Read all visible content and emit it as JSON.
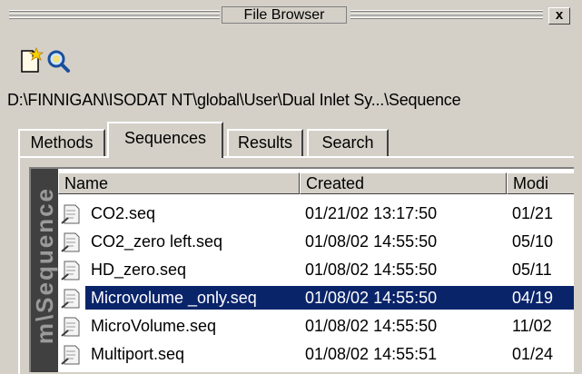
{
  "window": {
    "title": "File Browser",
    "close_label": "x"
  },
  "toolbar": {
    "new_icon": "new-document-icon",
    "search_icon": "magnifier-icon"
  },
  "path": "D:\\FINNIGAN\\ISODAT NT\\global\\User\\Dual Inlet Sy...\\Sequence",
  "tabs": [
    {
      "label": "Methods"
    },
    {
      "label": "Sequences",
      "active": true
    },
    {
      "label": "Results"
    },
    {
      "label": "Search"
    }
  ],
  "side_label": "m\\Sequence",
  "columns": {
    "name": "Name",
    "created": "Created",
    "modified": "Modi"
  },
  "files": [
    {
      "name": "CO2.seq",
      "created": "01/21/02 13:17:50",
      "modified": "01/21"
    },
    {
      "name": "CO2_zero left.seq",
      "created": "01/08/02 14:55:50",
      "modified": "05/10"
    },
    {
      "name": "HD_zero.seq",
      "created": "01/08/02 14:55:50",
      "modified": "05/11"
    },
    {
      "name": "Microvolume _only.seq",
      "created": "01/08/02 14:55:50",
      "modified": "04/19",
      "selected": true
    },
    {
      "name": "MicroVolume.seq",
      "created": "01/08/02 14:55:50",
      "modified": "11/02"
    },
    {
      "name": "Multiport.seq",
      "created": "01/08/02 14:55:51",
      "modified": "01/24"
    }
  ],
  "colors": {
    "selection": "#0a246a",
    "background": "#d4d0c8",
    "side_strip": "#404040"
  }
}
